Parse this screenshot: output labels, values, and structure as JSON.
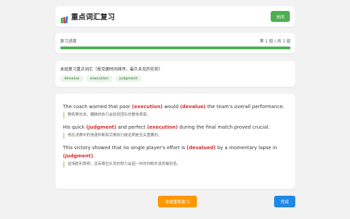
{
  "header": {
    "title": "重点词汇复习",
    "close_label": "关闭",
    "icon": "books-icon"
  },
  "progress": {
    "label": "复习进度",
    "status": "第 1 组 / 共 1 组",
    "percent": 100,
    "color": "#4caf50"
  },
  "words": {
    "title": "本组复习重点词汇（按见面时间排序，最久未见的在前）",
    "tags": [
      "devalue",
      "execution",
      "judgment"
    ]
  },
  "paragraphs": [
    {
      "segments": [
        {
          "text": "The coach warned that poor ",
          "hl": false
        },
        {
          "text": "(execution)",
          "hl": true
        },
        {
          "text": " would ",
          "hl": false
        },
        {
          "text": "(devalue)",
          "hl": true
        },
        {
          "text": " the team's overall performance.",
          "hl": false
        }
      ],
      "translation": "教练警告说，糟糕的执行会贬低团队的整体表现。"
    },
    {
      "segments": [
        {
          "text": "His quick ",
          "hl": false
        },
        {
          "text": "(judgment)",
          "hl": true
        },
        {
          "text": " and perfect ",
          "hl": false
        },
        {
          "text": "(execution)",
          "hl": true
        },
        {
          "text": " during the final match proved crucial.",
          "hl": false
        }
      ],
      "translation": "他在决赛中的快速判断和完美执行被证明是至关重要的。"
    },
    {
      "segments": [
        {
          "text": "This victory showed that no single player's effort is ",
          "hl": false
        },
        {
          "text": "(devalued)",
          "hl": true
        },
        {
          "text": " by a momentary lapse in ",
          "hl": false
        },
        {
          "text": "(judgment)",
          "hl": true
        },
        {
          "text": ".",
          "hl": false
        }
      ],
      "translation": "这场胜利表明，没有哪位队员的努力会因一时的判断失误而被贬低。"
    }
  ],
  "buttons": {
    "regenerate": "本组重新复习",
    "done": "完成"
  },
  "colors": {
    "accent_green": "#4caf50",
    "highlight_red": "#d32f2f",
    "regen_orange": "#ff9800",
    "done_blue": "#1e88e5"
  }
}
